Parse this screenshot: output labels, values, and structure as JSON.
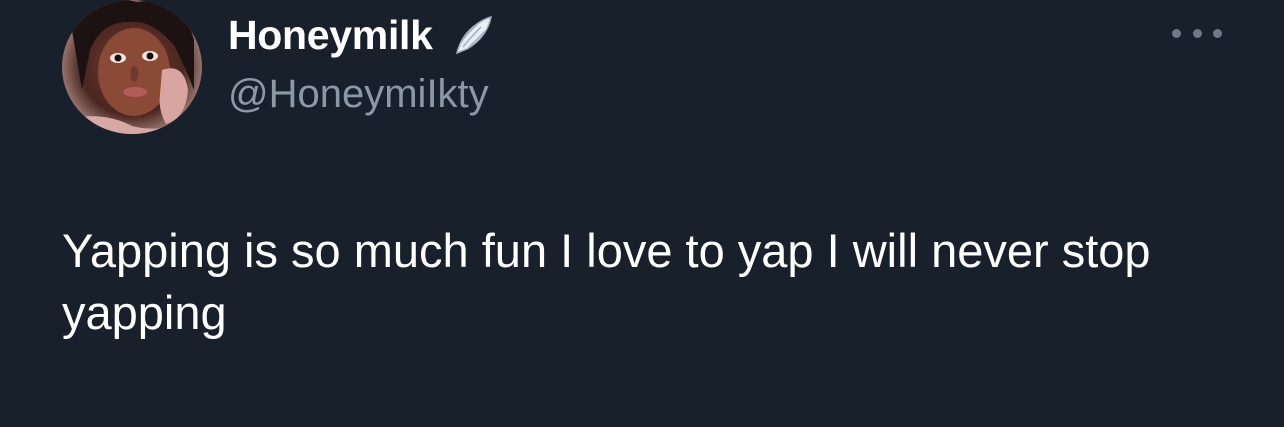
{
  "tweet": {
    "author": {
      "display_name": "Honeymilk",
      "handle": "@HoneymiIkty",
      "badge_icon": "angel-wing-icon",
      "avatar_icon": "profile-photo"
    },
    "more_icon": "more-options-icon",
    "text": "Yapping is so much fun I love to yap I will never stop yapping"
  },
  "colors": {
    "background": "#17202b",
    "primary_text": "#ffffff",
    "secondary_text": "#8b98a5"
  }
}
